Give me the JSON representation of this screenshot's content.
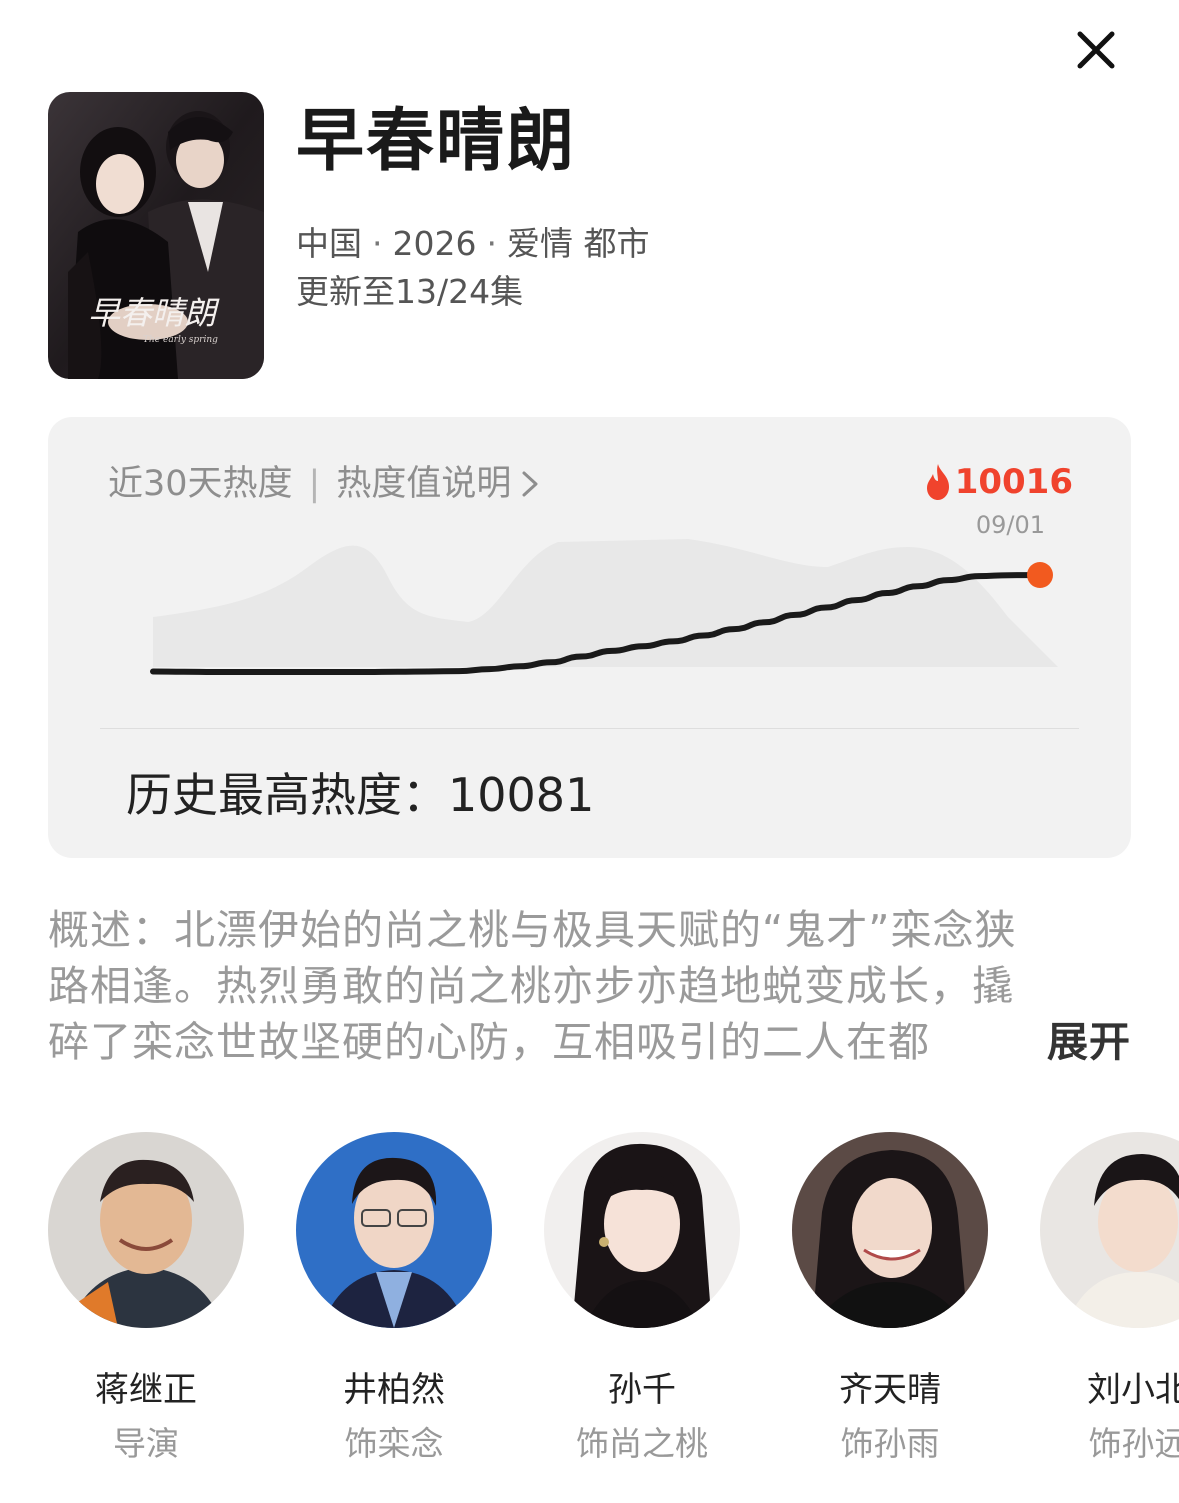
{
  "drama": {
    "title": "早春晴朗",
    "country": "中国",
    "year": "2026",
    "genres": "爱情 都市",
    "separator": "·",
    "episode_progress": "更新至13/24集",
    "poster_title_art": "早春晴朗",
    "poster_subtitle_art": "The early spring"
  },
  "heat": {
    "header_label": "近30天热度",
    "divider": "|",
    "explain_link": "热度值说明",
    "current_value": "10016",
    "current_date": "09/01",
    "max_label": "历史最高热度：",
    "max_value": "10081"
  },
  "chart_data": {
    "type": "line",
    "title": "",
    "xlabel": "",
    "ylabel": "",
    "grid": false,
    "series": [
      {
        "values": [
          6880,
          6870,
          6865,
          6865,
          6865,
          6865,
          6865,
          6865,
          6870,
          6880,
          6895,
          6960,
          7050,
          7180,
          7370,
          7550,
          7700,
          7860,
          8050,
          8260,
          8480,
          8720,
          8960,
          9200,
          9430,
          9650,
          9850,
          9980,
          10010,
          10016
        ]
      }
    ],
    "highlight_point": {
      "index": 29,
      "value": 10016,
      "label": "09/01"
    },
    "line_color": "#1a1a1a",
    "point_color": "#f25a1f",
    "area_color": "#e6e6e6"
  },
  "synopsis": {
    "lines": [
      "概述：北漂伊始的尚之桃与极具天赋的“鬼才”栾念狭",
      "路相逢。热烈勇敢的尚之桃亦步亦趋地蜕变成长，撬",
      "碎了栾念世故坚硬的心防，互相吸引的二人在都"
    ],
    "expand_label": "展开"
  },
  "cast": [
    {
      "name": "蒋继正",
      "role": "导演"
    },
    {
      "name": "井柏然",
      "role": "饰栾念"
    },
    {
      "name": "孙千",
      "role": "饰尚之桃"
    },
    {
      "name": "齐天晴",
      "role": "饰孙雨"
    },
    {
      "name": "刘小北",
      "role": "饰孙远"
    }
  ],
  "colors": {
    "accent": "#f0432d",
    "card_bg": "#f2f2f2",
    "muted_text": "#9a9a9a"
  },
  "icons": {
    "close": "close-icon",
    "flame": "flame-icon",
    "chevron": "chevron-right-icon"
  }
}
